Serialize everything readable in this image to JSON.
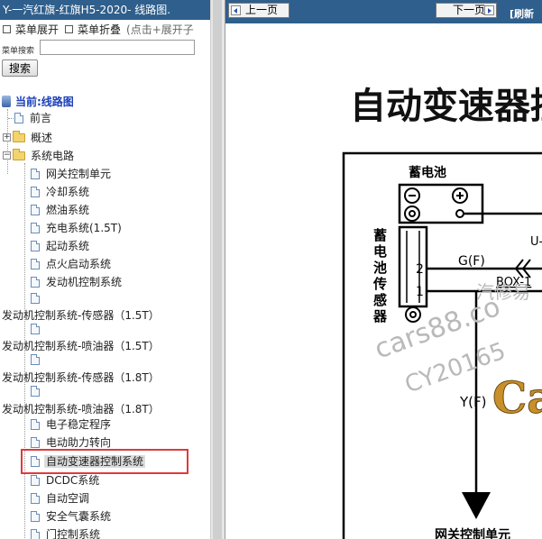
{
  "left": {
    "title": "Y-一汽红旗-红旗H5-2020- 线路图.",
    "menu_expand": "菜单展开",
    "menu_collapse": "菜单折叠",
    "menu_hint": "(点击+展开子",
    "search_label": "菜单搜索",
    "search_value": "",
    "search_button": "搜索",
    "root_label": "当前:线路图",
    "items": [
      {
        "label": "前言"
      },
      {
        "label": "概述"
      },
      {
        "label": "系统电路"
      },
      {
        "label": "网关控制单元"
      },
      {
        "label": "冷却系统"
      },
      {
        "label": "燃油系统"
      },
      {
        "label": "充电系统(1.5T)"
      },
      {
        "label": "起动系统"
      },
      {
        "label": "点火启动系统"
      },
      {
        "label": "发动机控制系统"
      },
      {
        "label": "发动机控制系统-传感器（1.5T）"
      },
      {
        "label": "发动机控制系统-喷油器（1.5T）"
      },
      {
        "label": "发动机控制系统-传感器（1.8T）"
      },
      {
        "label": "发动机控制系统-喷油器（1.8T）"
      },
      {
        "label": "电子稳定程序"
      },
      {
        "label": "电动助力转向"
      },
      {
        "label": "自动变速器控制系统"
      },
      {
        "label": "DCDC系统"
      },
      {
        "label": "自动空调"
      },
      {
        "label": "安全气囊系统"
      },
      {
        "label": "门控制系统"
      }
    ]
  },
  "right": {
    "prev_button": "上一页",
    "next_button": "下一页",
    "refresh_link": "[刷新"
  },
  "diagram": {
    "title": "自动变速器控",
    "battery_label": "蓄电池",
    "sensor_label": [
      "蓄",
      "电",
      "池",
      "传",
      "感",
      "器"
    ],
    "pin_2": "2",
    "pin_1": "1",
    "wire_gf": "G(F)",
    "wire_yf": "Y(F)",
    "wire_u": "U-",
    "connector_box": "BOX-1",
    "bottom_label": "网关控制单元",
    "watermark_lines": [
      "汽修易",
      "cars88.co",
      "CY20165"
    ],
    "logo_text": "Ca"
  }
}
